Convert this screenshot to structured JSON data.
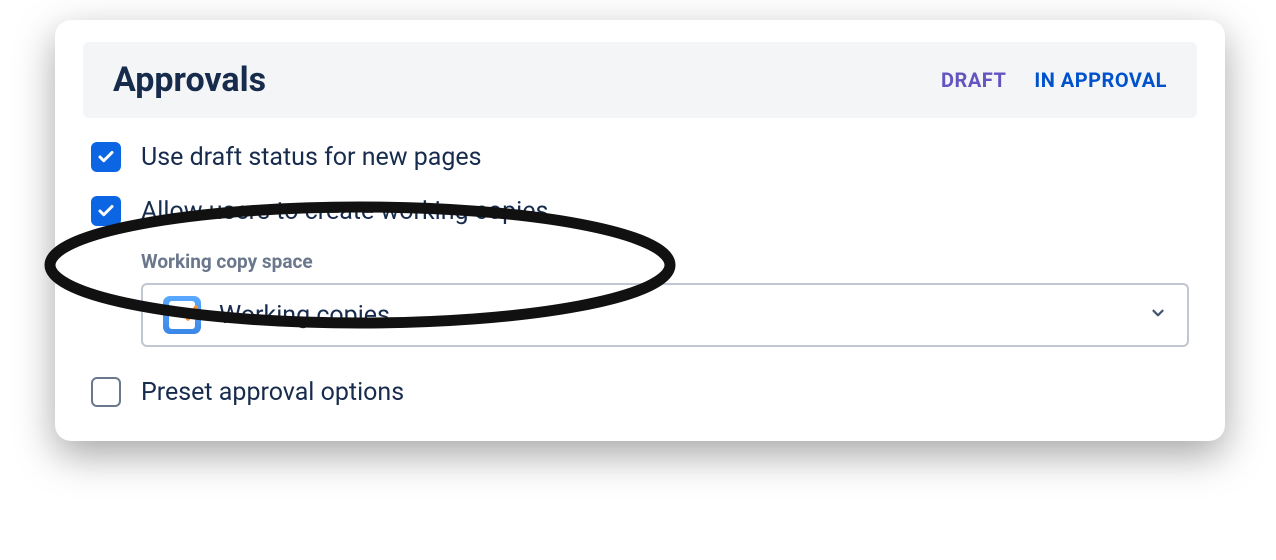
{
  "header": {
    "title": "Approvals",
    "status_draft": "DRAFT",
    "status_in_approval": "IN APPROVAL"
  },
  "options": {
    "use_draft": {
      "label": "Use draft status for new pages",
      "checked": true
    },
    "allow_working_copies": {
      "label": "Allow users to create working copies",
      "checked": true
    },
    "preset_approval": {
      "label": "Preset approval options",
      "checked": false
    }
  },
  "working_copy_space": {
    "field_label": "Working copy space",
    "selected_value": "Working copies"
  }
}
